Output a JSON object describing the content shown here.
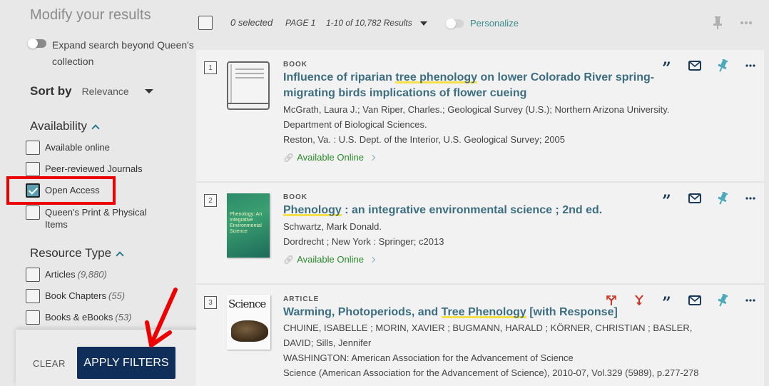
{
  "sidebar": {
    "title": "Modify your results",
    "expand_toggle": {
      "label": "Expand search beyond Queen's collection",
      "on": false
    },
    "sort": {
      "label": "Sort by",
      "value": "Relevance"
    },
    "facets": [
      {
        "title": "Availability",
        "items": [
          {
            "label": "Available online",
            "checked": false
          },
          {
            "label": "Peer-reviewed Journals",
            "checked": false
          },
          {
            "label": "Open Access",
            "checked": true
          },
          {
            "label": "Queen's Print & Physical Items",
            "checked": false
          }
        ]
      },
      {
        "title": "Resource Type",
        "items": [
          {
            "label": "Articles",
            "count": "(9,880)",
            "checked": false
          },
          {
            "label": "Book Chapters",
            "count": "(55)",
            "checked": false
          },
          {
            "label": "Books & eBooks",
            "count": "(53)",
            "checked": false
          }
        ]
      }
    ],
    "clear_label": "CLEAR",
    "apply_label": "APPLY FILTERS"
  },
  "toolbar": {
    "selected": "0 selected",
    "page": "PAGE 1",
    "results_range": "1-10 of 10,782 Results",
    "personalize_label": "Personalize",
    "personalize_on": false
  },
  "results": [
    {
      "number": "1",
      "type": "BOOK",
      "title_parts": [
        "Influence of riparian ",
        "tree phenology",
        " on lower Colorado River spring-migrating birds implications of flower cueing"
      ],
      "lines": [
        "McGrath, Laura J.; Van Riper, Charles.; Geological Survey (U.S.); Northern Arizona University. Department of Biological Sciences.",
        "Reston, Va. : U.S. Dept. of the Interior, U.S. Geological Survey; 2005"
      ],
      "availability": "Available Online",
      "thumbnail": "generic-book-icon"
    },
    {
      "number": "2",
      "type": "BOOK",
      "title_parts": [
        "",
        "Phenology",
        " : an integrative environmental science ; 2nd ed."
      ],
      "lines": [
        "Schwartz, Mark Donald.",
        "Dordrecht ; New York : Springer; c2013"
      ],
      "availability": "Available Online",
      "thumbnail": "phenology-book-cover",
      "cover_text": "Phenology: An Integrative Environmental Science"
    },
    {
      "number": "3",
      "type": "ARTICLE",
      "title_parts": [
        "Warming, Photoperiods, and ",
        "Tree Phenology",
        " [with Response]"
      ],
      "lines": [
        "CHUINE, ISABELLE ; MORIN, XAVIER ; BUGMANN, HARALD ; KÖRNER, CHRISTIAN ; BASLER, DAVID; Sills, Jennifer",
        "WASHINGTON: American Association for the Advancement of Science",
        "Science (American Association for the Advancement of Science), 2010-07, Vol.329 (5989), p.277-278"
      ],
      "thumbnail": "science-journal-cover",
      "cover_text": "Science"
    }
  ],
  "colors": {
    "accent": "#3c6e80",
    "apply_button": "#0f2e5a",
    "available_green": "#2a8a2a",
    "highlight": "#f5e049",
    "annotation_red": "#e00000",
    "pin_teal": "#4aa8b8"
  }
}
